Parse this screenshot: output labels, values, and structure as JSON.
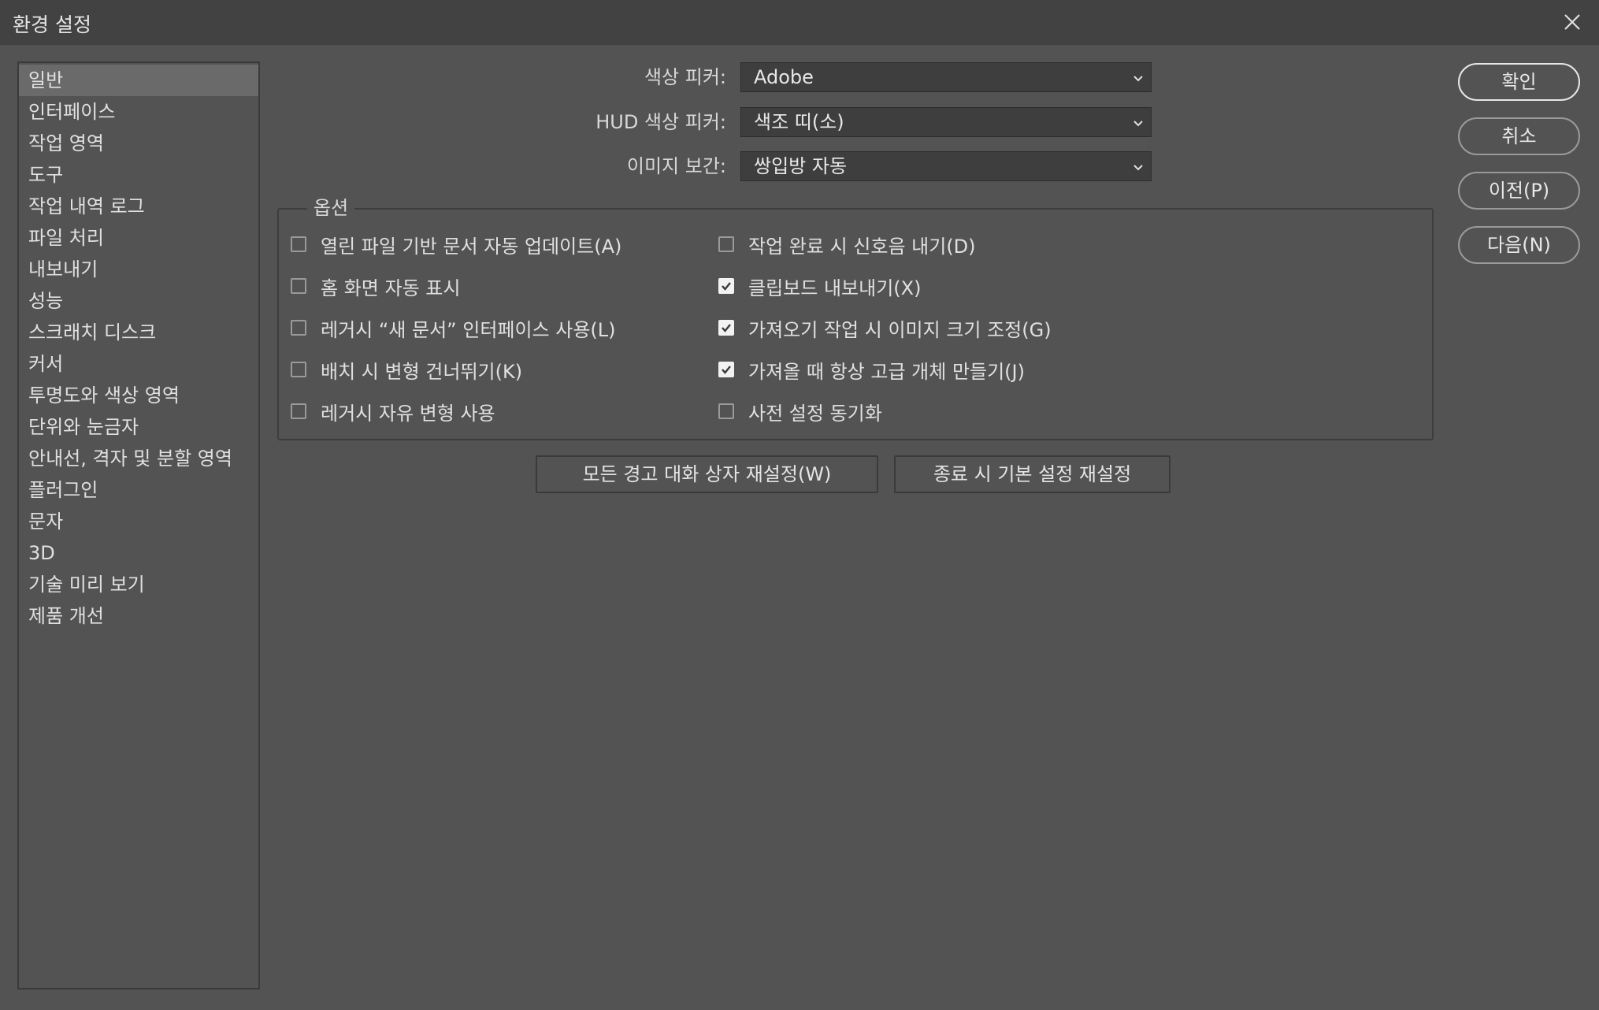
{
  "window": {
    "title": "환경 설정"
  },
  "sidebar": {
    "items": [
      {
        "label": "일반",
        "selected": true
      },
      {
        "label": "인터페이스"
      },
      {
        "label": "작업 영역"
      },
      {
        "label": "도구"
      },
      {
        "label": "작업 내역 로그"
      },
      {
        "label": "파일 처리"
      },
      {
        "label": "내보내기"
      },
      {
        "label": "성능"
      },
      {
        "label": "스크래치 디스크"
      },
      {
        "label": "커서"
      },
      {
        "label": "투명도와 색상 영역"
      },
      {
        "label": "단위와 눈금자"
      },
      {
        "label": "안내선, 격자 및 분할 영역"
      },
      {
        "label": "플러그인"
      },
      {
        "label": "문자"
      },
      {
        "label": "3D"
      },
      {
        "label": "기술 미리 보기"
      },
      {
        "label": "제품 개선"
      }
    ]
  },
  "fields": {
    "color_picker": {
      "label": "색상 피커:",
      "value": "Adobe"
    },
    "hud_color_picker": {
      "label": "HUD 색상 피커:",
      "value": "색조 띠(소)"
    },
    "image_interpolation": {
      "label": "이미지 보간:",
      "value": "쌍입방 자동"
    }
  },
  "options": {
    "legend": "옵션",
    "left": [
      {
        "label": "열린 파일 기반 문서 자동 업데이트(A)",
        "checked": false
      },
      {
        "label": "홈 화면 자동 표시",
        "checked": false
      },
      {
        "label": "레거시 “새 문서” 인터페이스 사용(L)",
        "checked": false
      },
      {
        "label": "배치 시 변형 건너뛰기(K)",
        "checked": false
      },
      {
        "label": "레거시 자유 변형 사용",
        "checked": false
      }
    ],
    "right": [
      {
        "label": "작업 완료 시 신호음 내기(D)",
        "checked": false
      },
      {
        "label": "클립보드 내보내기(X)",
        "checked": true
      },
      {
        "label": "가져오기 작업 시 이미지 크기 조정(G)",
        "checked": true
      },
      {
        "label": "가져올 때 항상 고급 개체 만들기(J)",
        "checked": true
      },
      {
        "label": "사전 설정 동기화",
        "checked": false
      }
    ]
  },
  "actions": {
    "reset_warnings": "모든 경고 대화 상자 재설정(W)",
    "reset_on_quit": "종료 시 기본 설정 재설정"
  },
  "buttons": {
    "ok": "확인",
    "cancel": "취소",
    "prev": "이전(P)",
    "next": "다음(N)"
  }
}
